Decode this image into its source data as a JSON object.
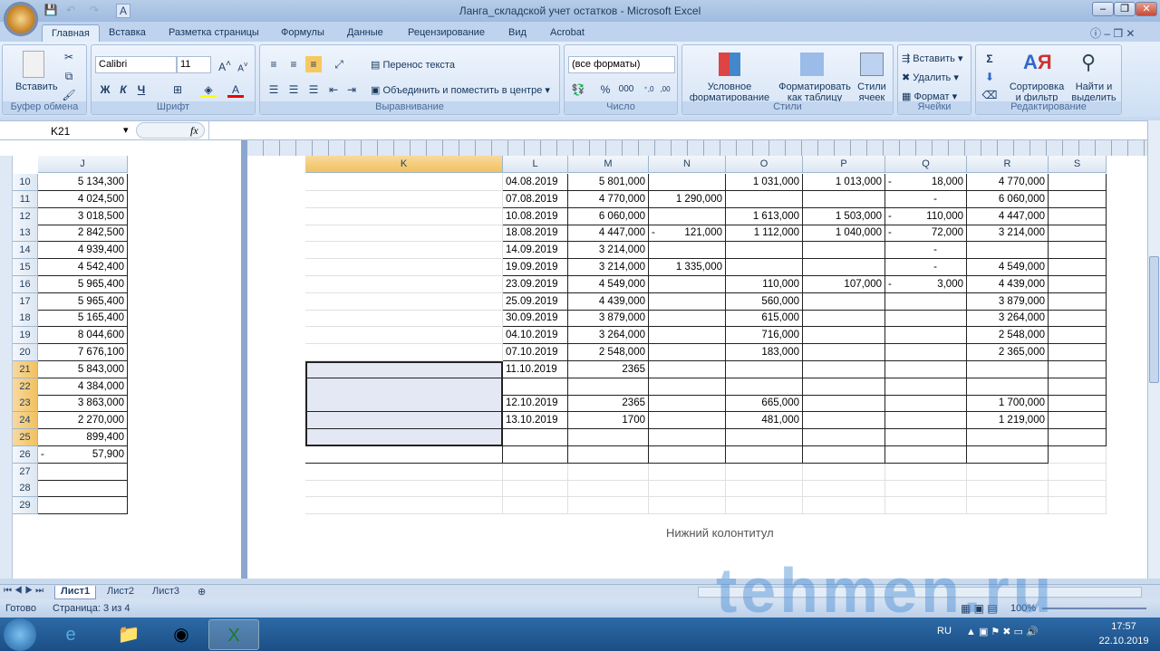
{
  "window": {
    "title": "Ланга_складской учет остатков - Microsoft Excel"
  },
  "tabs": [
    "Главная",
    "Вставка",
    "Разметка страницы",
    "Формулы",
    "Данные",
    "Рецензирование",
    "Вид",
    "Acrobat"
  ],
  "ribbon": {
    "clipboard": {
      "paste": "Вставить",
      "label": "Буфер обмена"
    },
    "font": {
      "name": "Calibri",
      "size": "11",
      "bold": "Ж",
      "italic": "К",
      "underline": "Ч",
      "label": "Шрифт"
    },
    "alignment": {
      "wrap": "Перенос текста",
      "merge": "Объединить и поместить в центре",
      "label": "Выравнивание"
    },
    "number": {
      "format": "(все форматы)",
      "percent": "%",
      "thousands": "000",
      "label": "Число"
    },
    "styles": {
      "conditional": "Условное форматирование",
      "as_table": "Форматировать как таблицу",
      "cell_styles": "Стили ячеек",
      "label": "Стили"
    },
    "cells": {
      "insert": "Вставить",
      "delete": "Удалить",
      "format": "Формат",
      "label": "Ячейки"
    },
    "editing": {
      "sort": "Сортировка и фильтр",
      "find": "Найти и выделить",
      "label": "Редактирование"
    }
  },
  "formula_bar": {
    "name_box": "K21",
    "fx": "fx",
    "value": ""
  },
  "left_pane": {
    "column": "J",
    "rows": [
      {
        "n": "10",
        "j": "5 134,300"
      },
      {
        "n": "11",
        "j": "4 024,500"
      },
      {
        "n": "12",
        "j": "3 018,500"
      },
      {
        "n": "13",
        "j": "2 842,500"
      },
      {
        "n": "14",
        "j": "4 939,400"
      },
      {
        "n": "15",
        "j": "4 542,400"
      },
      {
        "n": "16",
        "j": "5 965,400"
      },
      {
        "n": "17",
        "j": "5 965,400"
      },
      {
        "n": "18",
        "j": "5 165,400"
      },
      {
        "n": "19",
        "j": "8 044,600"
      },
      {
        "n": "20",
        "j": "7 676,100"
      },
      {
        "n": "21",
        "j": "5 843,000"
      },
      {
        "n": "22",
        "j": "4 384,000"
      },
      {
        "n": "23",
        "j": "3 863,000"
      },
      {
        "n": "24",
        "j": "2 270,000"
      },
      {
        "n": "25",
        "j": "899,400"
      },
      {
        "n": "26",
        "j": "- 57,900"
      },
      {
        "n": "27",
        "j": ""
      },
      {
        "n": "28",
        "j": ""
      },
      {
        "n": "29",
        "j": ""
      }
    ]
  },
  "right_pane": {
    "columns": [
      "K",
      "L",
      "M",
      "N",
      "O",
      "P",
      "Q",
      "R",
      "S"
    ],
    "rows": [
      [
        "",
        "04.08.2019",
        "5 801,000",
        "",
        "1 031,000",
        "1 013,000",
        "- 18,000",
        "4 770,000",
        ""
      ],
      [
        "",
        "07.08.2019",
        "4 770,000",
        "1 290,000",
        "",
        "",
        "-",
        "6 060,000",
        ""
      ],
      [
        "",
        "10.08.2019",
        "6 060,000",
        "",
        "1 613,000",
        "1 503,000",
        "- 110,000",
        "4 447,000",
        ""
      ],
      [
        "",
        "18.08.2019",
        "4 447,000",
        "- 121,000",
        "1 112,000",
        "1 040,000",
        "- 72,000",
        "3 214,000",
        ""
      ],
      [
        "",
        "14.09.2019",
        "3 214,000",
        "",
        "",
        "",
        "-",
        "",
        ""
      ],
      [
        "",
        "19.09.2019",
        "3 214,000",
        "1 335,000",
        "",
        "",
        "-",
        "4 549,000",
        ""
      ],
      [
        "",
        "23.09.2019",
        "4 549,000",
        "",
        "110,000",
        "107,000",
        "- 3,000",
        "4 439,000",
        ""
      ],
      [
        "",
        "25.09.2019",
        "4 439,000",
        "",
        "560,000",
        "",
        "",
        "3 879,000",
        ""
      ],
      [
        "",
        "30.09.2019",
        "3 879,000",
        "",
        "615,000",
        "",
        "",
        "3 264,000",
        ""
      ],
      [
        "",
        "04.10.2019",
        "3 264,000",
        "",
        "716,000",
        "",
        "",
        "2 548,000",
        ""
      ],
      [
        "",
        "07.10.2019",
        "2 548,000",
        "",
        "183,000",
        "",
        "",
        "2 365,000",
        ""
      ],
      [
        "",
        "11.10.2019",
        "2365",
        "",
        "",
        "",
        "",
        "",
        ""
      ],
      [
        "",
        "",
        "",
        "",
        "",
        "",
        "",
        "",
        ""
      ],
      [
        "",
        "12.10.2019",
        "2365",
        "",
        "665,000",
        "",
        "",
        "1 700,000",
        ""
      ],
      [
        "",
        "13.10.2019",
        "1700",
        "",
        "481,000",
        "",
        "",
        "1 219,000",
        ""
      ],
      [
        "",
        "",
        "",
        "",
        "",
        "",
        "",
        "",
        ""
      ],
      [
        "",
        "",
        "",
        "",
        "",
        "",
        "",
        "",
        ""
      ],
      [
        "",
        "",
        "",
        "",
        "",
        "",
        "",
        "",
        ""
      ],
      [
        "",
        "",
        "",
        "",
        "",
        "",
        "",
        "",
        ""
      ],
      [
        "",
        "",
        "",
        "",
        "",
        "",
        "",
        "",
        ""
      ]
    ],
    "footer": "Нижний колонтитул"
  },
  "sheets": [
    "Лист1",
    "Лист2",
    "Лист3"
  ],
  "status": {
    "ready": "Готово",
    "page": "Страница: 3 из 4",
    "zoom": "100%"
  },
  "taskbar": {
    "lang": "RU",
    "time": "17:57",
    "date": "22.10.2019"
  },
  "watermark": "tehmen.ru"
}
